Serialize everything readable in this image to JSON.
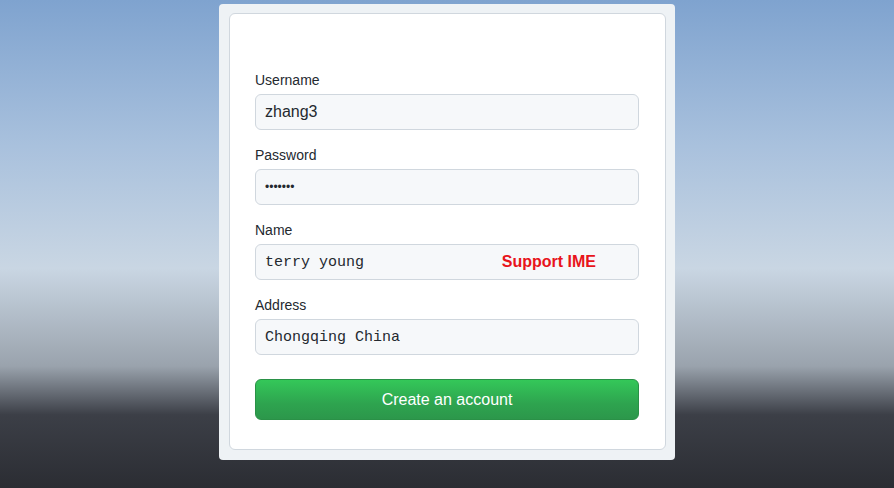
{
  "form": {
    "fields": [
      {
        "label": "Username",
        "value": "zhang3",
        "kind": "text"
      },
      {
        "label": "Password",
        "value": "•••••••",
        "kind": "password"
      },
      {
        "label": "Name",
        "value": "terry young",
        "kind": "mono",
        "badge": "Support IME"
      },
      {
        "label": "Address",
        "value": "Chongqing China",
        "kind": "mono"
      }
    ],
    "submit": "Create an account"
  }
}
